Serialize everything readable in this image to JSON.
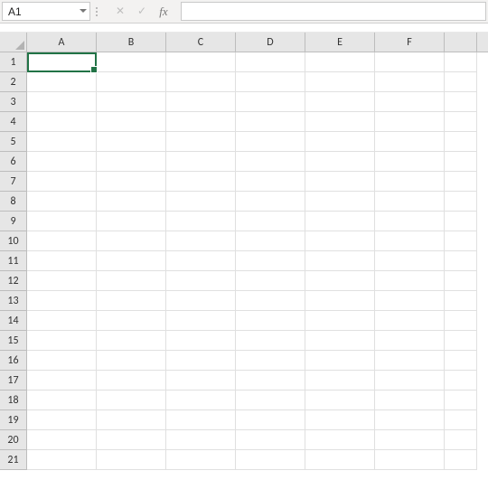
{
  "formula_bar": {
    "name_box_value": "A1",
    "cancel_label": "✕",
    "enter_label": "✓",
    "fx_label": "fx",
    "formula_value": ""
  },
  "sheet": {
    "columns": [
      "A",
      "B",
      "C",
      "D",
      "E",
      "F",
      ""
    ],
    "rows": [
      "1",
      "2",
      "3",
      "4",
      "5",
      "6",
      "7",
      "8",
      "9",
      "10",
      "11",
      "12",
      "13",
      "14",
      "15",
      "16",
      "17",
      "18",
      "19",
      "20",
      "21"
    ],
    "active_cell": "A1",
    "cells": {}
  },
  "colors": {
    "selection_border": "#217346"
  }
}
